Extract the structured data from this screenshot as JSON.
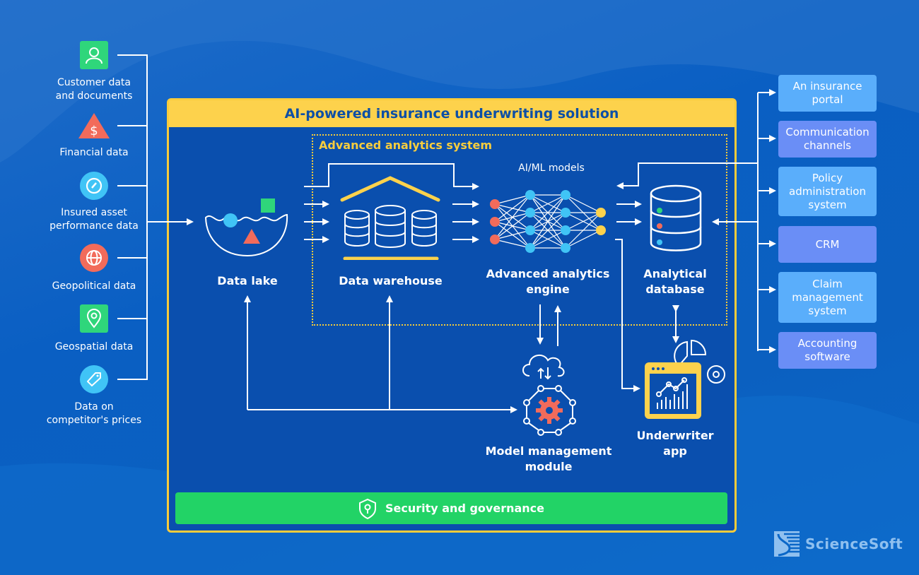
{
  "title": "AI-powered insurance underwriting solution",
  "subsystem_title": "Advanced analytics system",
  "sources": [
    {
      "label_lines": [
        "Customer data",
        "and documents"
      ],
      "icon": "user-icon",
      "color": "#2fd67b",
      "shape": "square"
    },
    {
      "label_lines": [
        "Financial data"
      ],
      "icon": "dollar-warning-icon",
      "color": "#f26b5b",
      "shape": "triangle"
    },
    {
      "label_lines": [
        "Insured asset",
        "performance data"
      ],
      "icon": "gauge-icon",
      "color": "#40c4f6",
      "shape": "circle"
    },
    {
      "label_lines": [
        "Geopolitical data"
      ],
      "icon": "globe-icon",
      "color": "#f26b5b",
      "shape": "circle"
    },
    {
      "label_lines": [
        "Geospatial data"
      ],
      "icon": "map-pin-icon",
      "color": "#2fd67b",
      "shape": "square"
    },
    {
      "label_lines": [
        "Data on",
        "competitor's prices"
      ],
      "icon": "price-tag-icon",
      "color": "#40c4f6",
      "shape": "circle"
    }
  ],
  "nodes": {
    "data_lake": {
      "label": "Data lake"
    },
    "data_warehouse": {
      "label": "Data warehouse"
    },
    "ai_ml_models": {
      "label": "AI/ML models"
    },
    "analytics_engine": {
      "label_lines": [
        "Advanced analytics",
        "engine"
      ]
    },
    "analytical_database": {
      "label_lines": [
        "Analytical",
        "database"
      ]
    },
    "model_management": {
      "label_lines": [
        "Model management",
        "module"
      ]
    },
    "underwriter_app": {
      "label_lines": [
        "Underwriter",
        "app"
      ]
    }
  },
  "security_bar": {
    "label": "Security and governance",
    "icon": "shield-icon"
  },
  "targets": [
    {
      "label_lines": [
        "An insurance",
        "portal"
      ],
      "style": "light"
    },
    {
      "label_lines": [
        "Communication",
        "channels"
      ],
      "style": "violet"
    },
    {
      "label_lines": [
        "Policy",
        "administration",
        "system"
      ],
      "style": "light"
    },
    {
      "label_lines": [
        "CRM"
      ],
      "style": "violet"
    },
    {
      "label_lines": [
        "Claim",
        "management",
        "system"
      ],
      "style": "light"
    },
    {
      "label_lines": [
        "Accounting",
        "software"
      ],
      "style": "violet"
    }
  ],
  "brand": {
    "name": "ScienceSoft"
  },
  "colors": {
    "background": "#0b60c0",
    "frame_yellow": "#f9cc3b",
    "header_text": "#0d4fa6",
    "security_green": "#22d366",
    "accent_red": "#f26b5b",
    "accent_cyan": "#40c4f6",
    "accent_green": "#2fd67b",
    "accent_yellow": "#fdd24c"
  }
}
